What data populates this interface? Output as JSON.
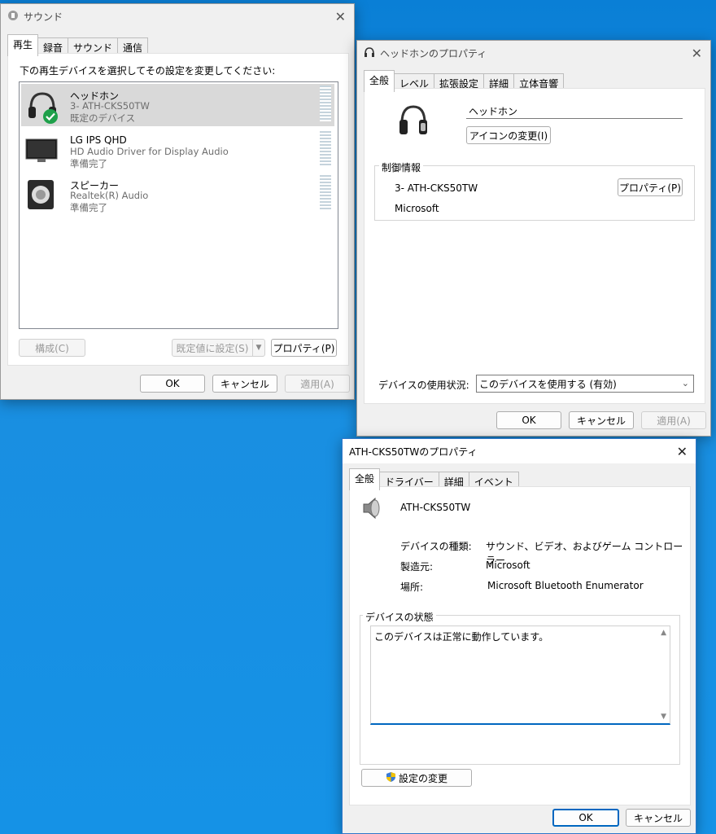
{
  "sound_window": {
    "title": "サウンド",
    "tabs": [
      "再生",
      "録音",
      "サウンド",
      "通信"
    ],
    "instruction": "下の再生デバイスを選択してその設定を変更してください:",
    "devices": [
      {
        "name": "ヘッドホン",
        "line2": "3- ATH-CKS50TW",
        "line3": "既定のデバイス",
        "icon": "headphones-icon",
        "selected": true
      },
      {
        "name": "LG IPS QHD",
        "line2": "HD Audio Driver for Display Audio",
        "line3": "準備完了",
        "icon": "monitor-icon",
        "selected": false
      },
      {
        "name": "スピーカー",
        "line2": "Realtek(R) Audio",
        "line3": "準備完了",
        "icon": "speaker-icon",
        "selected": false
      }
    ],
    "configure_label": "構成(C)",
    "set_default_label": "既定値に設定(S)",
    "properties_label": "プロパティ(P)",
    "ok_label": "OK",
    "cancel_label": "キャンセル",
    "apply_label": "適用(A)"
  },
  "headphone_props": {
    "title": "ヘッドホンのプロパティ",
    "tabs": [
      "全般",
      "レベル",
      "拡張設定",
      "詳細",
      "立体音響"
    ],
    "name_value": "ヘッドホン",
    "change_icon_label": "アイコンの変更(I)",
    "controller_group": "制御情報",
    "controller_name": "3- ATH-CKS50TW",
    "controller_props_label": "プロパティ(P)",
    "manufacturer": "Microsoft",
    "usage_label": "デバイスの使用状況:",
    "usage_value": "このデバイスを使用する (有効)",
    "ok_label": "OK",
    "cancel_label": "キャンセル",
    "apply_label": "適用(A)"
  },
  "device_props": {
    "title": "ATH-CKS50TWのプロパティ",
    "tabs": [
      "全般",
      "ドライバー",
      "詳細",
      "イベント"
    ],
    "device_name": "ATH-CKS50TW",
    "type_label": "デバイスの種類:",
    "type_value": "サウンド、ビデオ、およびゲーム コントローラー",
    "maker_label": "製造元:",
    "maker_value": "Microsoft",
    "location_label": "場所:",
    "location_value": "Microsoft Bluetooth Enumerator",
    "status_group": "デバイスの状態",
    "status_text": "このデバイスは正常に動作しています。",
    "change_settings_label": "設定の変更",
    "ok_label": "OK",
    "cancel_label": "キャンセル"
  }
}
